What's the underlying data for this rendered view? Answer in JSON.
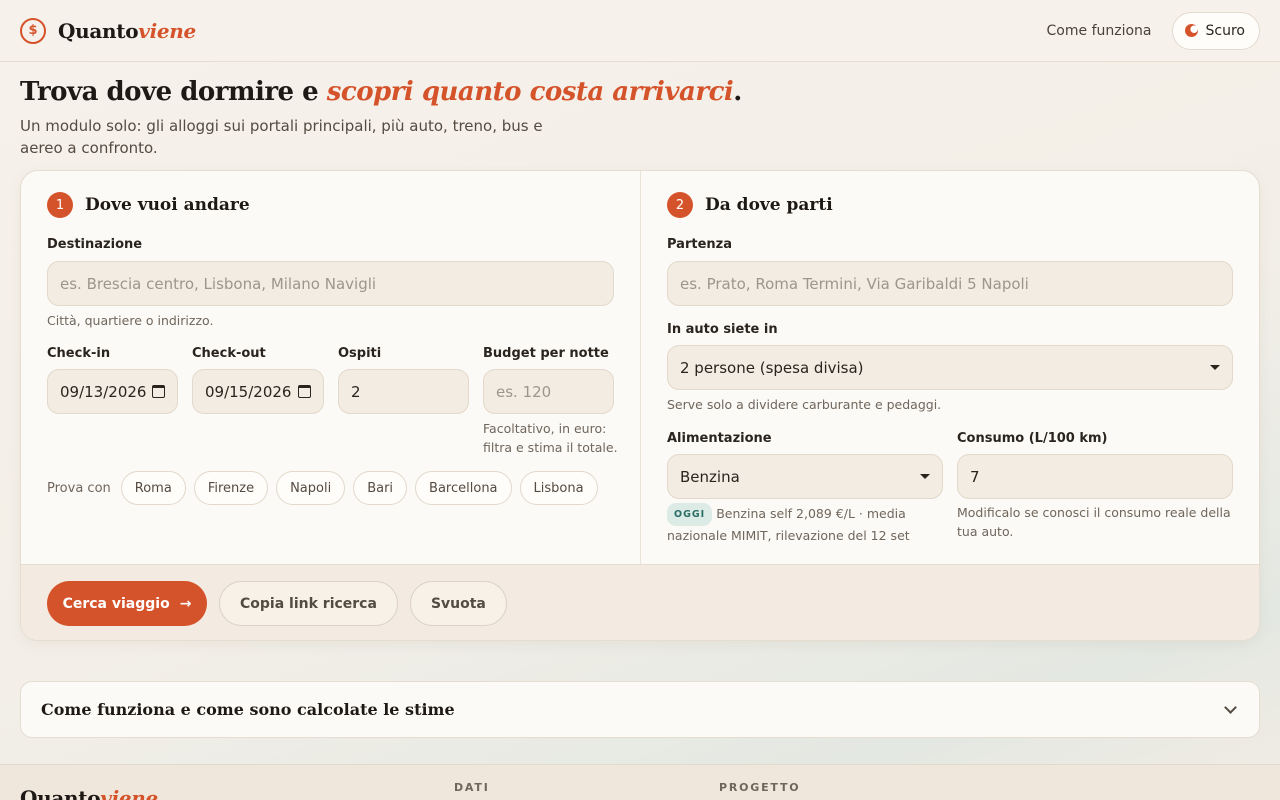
{
  "header": {
    "brand_main": "Quanto",
    "brand_accent": "viene",
    "nav_link": "Come funziona",
    "theme_toggle": "Scuro"
  },
  "hero": {
    "title_main": "Trova dove dormire e ",
    "title_accent": "scopri quanto costa arrivarci",
    "title_end": ".",
    "subtitle": "Un modulo solo: gli alloggi sui portali principali, più auto, treno, bus e aereo a confronto."
  },
  "step1": {
    "number": "1",
    "title": "Dove vuoi andare",
    "destination_label": "Destinazione",
    "destination_placeholder": "es. Brescia centro, Lisbona, Milano Navigli",
    "destination_hint": "Città, quartiere o indirizzo.",
    "checkin_label": "Check-in",
    "checkin_value": "09/13/2026",
    "checkout_label": "Check-out",
    "checkout_value": "09/15/2026",
    "guests_label": "Ospiti",
    "guests_value": "2",
    "budget_label": "Budget per notte",
    "budget_placeholder": "es. 120",
    "budget_hint": "Facoltativo, in euro: filtra e stima il totale.",
    "suggestions_label": "Prova con",
    "suggestions": [
      "Roma",
      "Firenze",
      "Napoli",
      "Bari",
      "Barcellona",
      "Lisbona"
    ]
  },
  "step2": {
    "number": "2",
    "title": "Da dove parti",
    "departure_label": "Partenza",
    "departure_placeholder": "es. Prato, Roma Termini, Via Garibaldi 5 Napoli",
    "car_label": "In auto siete in",
    "car_value": "2 persone (spesa divisa)",
    "car_hint": "Serve solo a dividere carburante e pedaggi.",
    "fuel_label": "Alimentazione",
    "fuel_value": "Benzina",
    "fuel_badge": "OGGI",
    "fuel_hint": "Benzina self 2,089 €/L · media nazionale MIMIT, rilevazione del 12 set",
    "consumption_label": "Consumo (L/100 km)",
    "consumption_value": "7",
    "consumption_hint": "Modificalo se conosci il consumo reale della tua auto."
  },
  "actions": {
    "search": "Cerca viaggio",
    "search_arrow": "→",
    "copy_link": "Copia link ricerca",
    "clear": "Svuota"
  },
  "accordion": {
    "title": "Come funziona e come sono calcolate le stime"
  },
  "footer": {
    "brand_main": "Quanto",
    "brand_accent": "viene",
    "col1": "DATI",
    "col2": "PROGETTO"
  },
  "colors": {
    "accent": "#d5532a",
    "badge": "#2b6e66"
  }
}
